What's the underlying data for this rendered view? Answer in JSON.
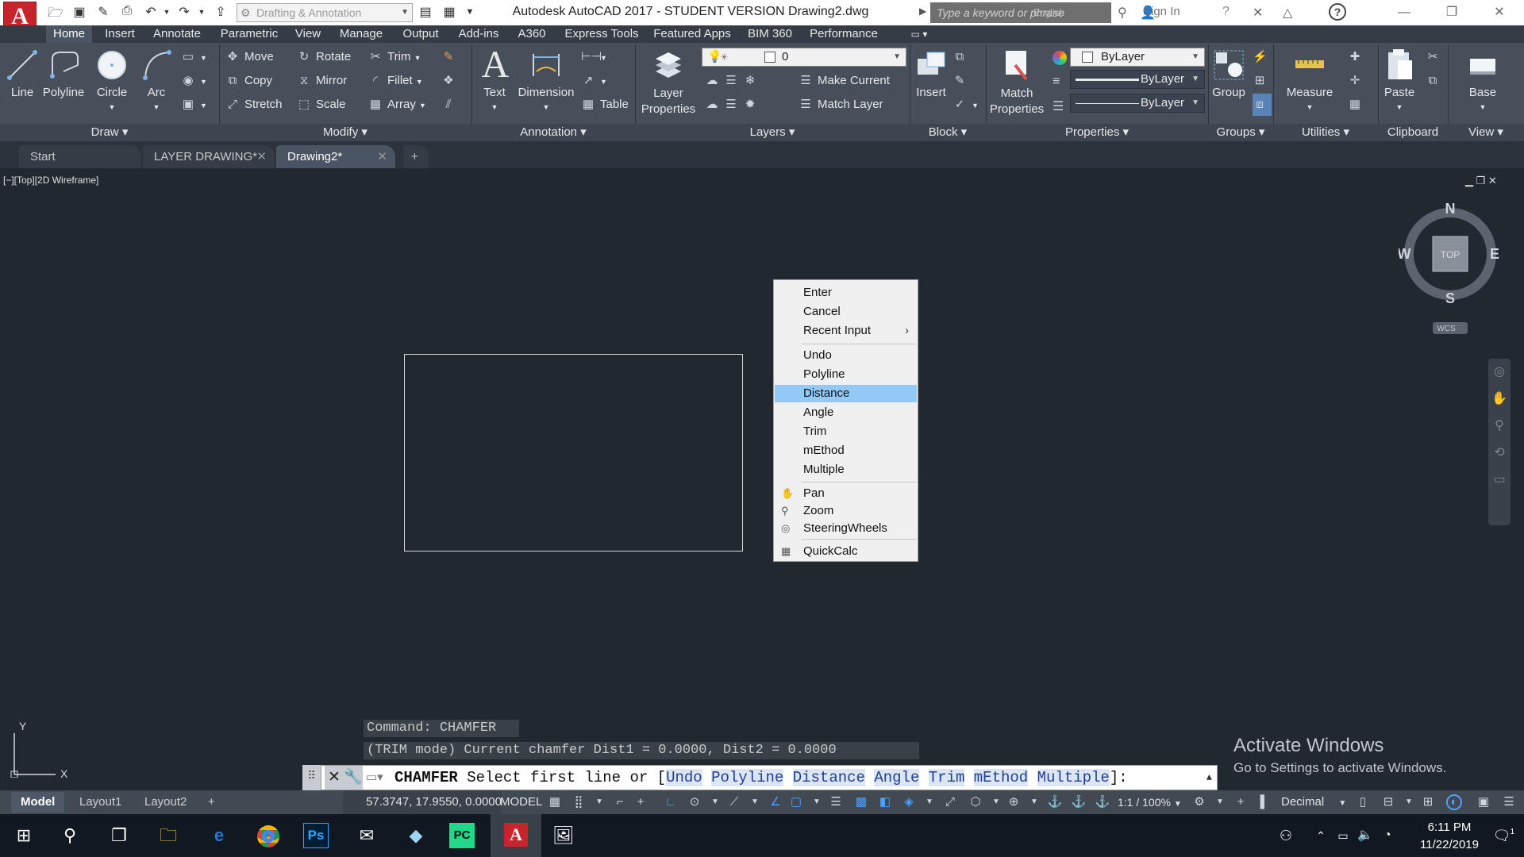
{
  "window": {
    "title": "Autodesk AutoCAD 2017 - STUDENT VERSION    Drawing2.dwg",
    "app_letter": "A",
    "workspace": "Drafting & Annotation",
    "search_placeholder": "Type a keyword or phrase",
    "search_lang": "English",
    "signin": "Sign In"
  },
  "ribbon_tabs": [
    "Home",
    "Insert",
    "Annotate",
    "Parametric",
    "View",
    "Manage",
    "Output",
    "Add-ins",
    "A360",
    "Express Tools",
    "Featured Apps",
    "BIM 360",
    "Performance"
  ],
  "draw": {
    "line": "Line",
    "polyline": "Polyline",
    "circle": "Circle",
    "arc": "Arc"
  },
  "modify": {
    "move": "Move",
    "rotate": "Rotate",
    "trim": "Trim",
    "copy": "Copy",
    "mirror": "Mirror",
    "fillet": "Fillet",
    "stretch": "Stretch",
    "scale": "Scale",
    "array": "Array"
  },
  "annotation": {
    "text": "Text",
    "dimension": "Dimension",
    "table": "Table"
  },
  "layers": {
    "layer_properties": "Layer Properties",
    "current_layer": "0",
    "make_current": "Make Current",
    "match_layer": "Match Layer"
  },
  "block": {
    "insert": "Insert"
  },
  "properties": {
    "match": "Match Properties",
    "color": "ByLayer",
    "linetype": "ByLayer",
    "lineweight": "ByLayer"
  },
  "groups": {
    "group": "Group"
  },
  "utilities": {
    "measure": "Measure"
  },
  "clipboard": {
    "paste": "Paste"
  },
  "view": {
    "base": "Base"
  },
  "panels": [
    "Draw",
    "Modify",
    "Annotation",
    "Layers",
    "Block",
    "Properties",
    "Groups",
    "Utilities",
    "Clipboard",
    "View"
  ],
  "doc_tabs": [
    "Start",
    "LAYER DRAWING*",
    "Drawing2*"
  ],
  "viewport_label": "[−][Top][2D Wireframe]",
  "context_menu": {
    "items": [
      "Enter",
      "Cancel",
      "Recent Input",
      "Undo",
      "Polyline",
      "Distance",
      "Angle",
      "Trim",
      "mEthod",
      "Multiple",
      "Pan",
      "Zoom",
      "SteeringWheels",
      "QuickCalc"
    ],
    "highlighted": "Distance"
  },
  "viewcube": {
    "n": "N",
    "s": "S",
    "e": "E",
    "w": "W",
    "face": "TOP",
    "wcs": "WCS"
  },
  "ucs": {
    "y": "Y",
    "x": "X"
  },
  "command": {
    "hist1": "Command: CHAMFER",
    "hist2": "(TRIM mode) Current chamfer Dist1 = 0.0000, Dist2 = 0.0000",
    "name": "CHAMFER",
    "prompt": "Select first line or [",
    "opts": [
      "Undo",
      "Polyline",
      "Distance",
      "Angle",
      "Trim",
      "mEthod",
      "Multiple"
    ],
    "end": "]:"
  },
  "watermark": {
    "title": "Activate Windows",
    "sub": "Go to Settings to activate Windows."
  },
  "status": {
    "layout_tabs": [
      "Model",
      "Layout1",
      "Layout2"
    ],
    "coords": "57.3747, 17.9550, 0.0000",
    "space": "MODEL",
    "scale": "1:1 / 100%",
    "units": "Decimal"
  },
  "taskbar": {
    "time": "6:11 PM",
    "date": "11/22/2019",
    "notif": "1"
  }
}
